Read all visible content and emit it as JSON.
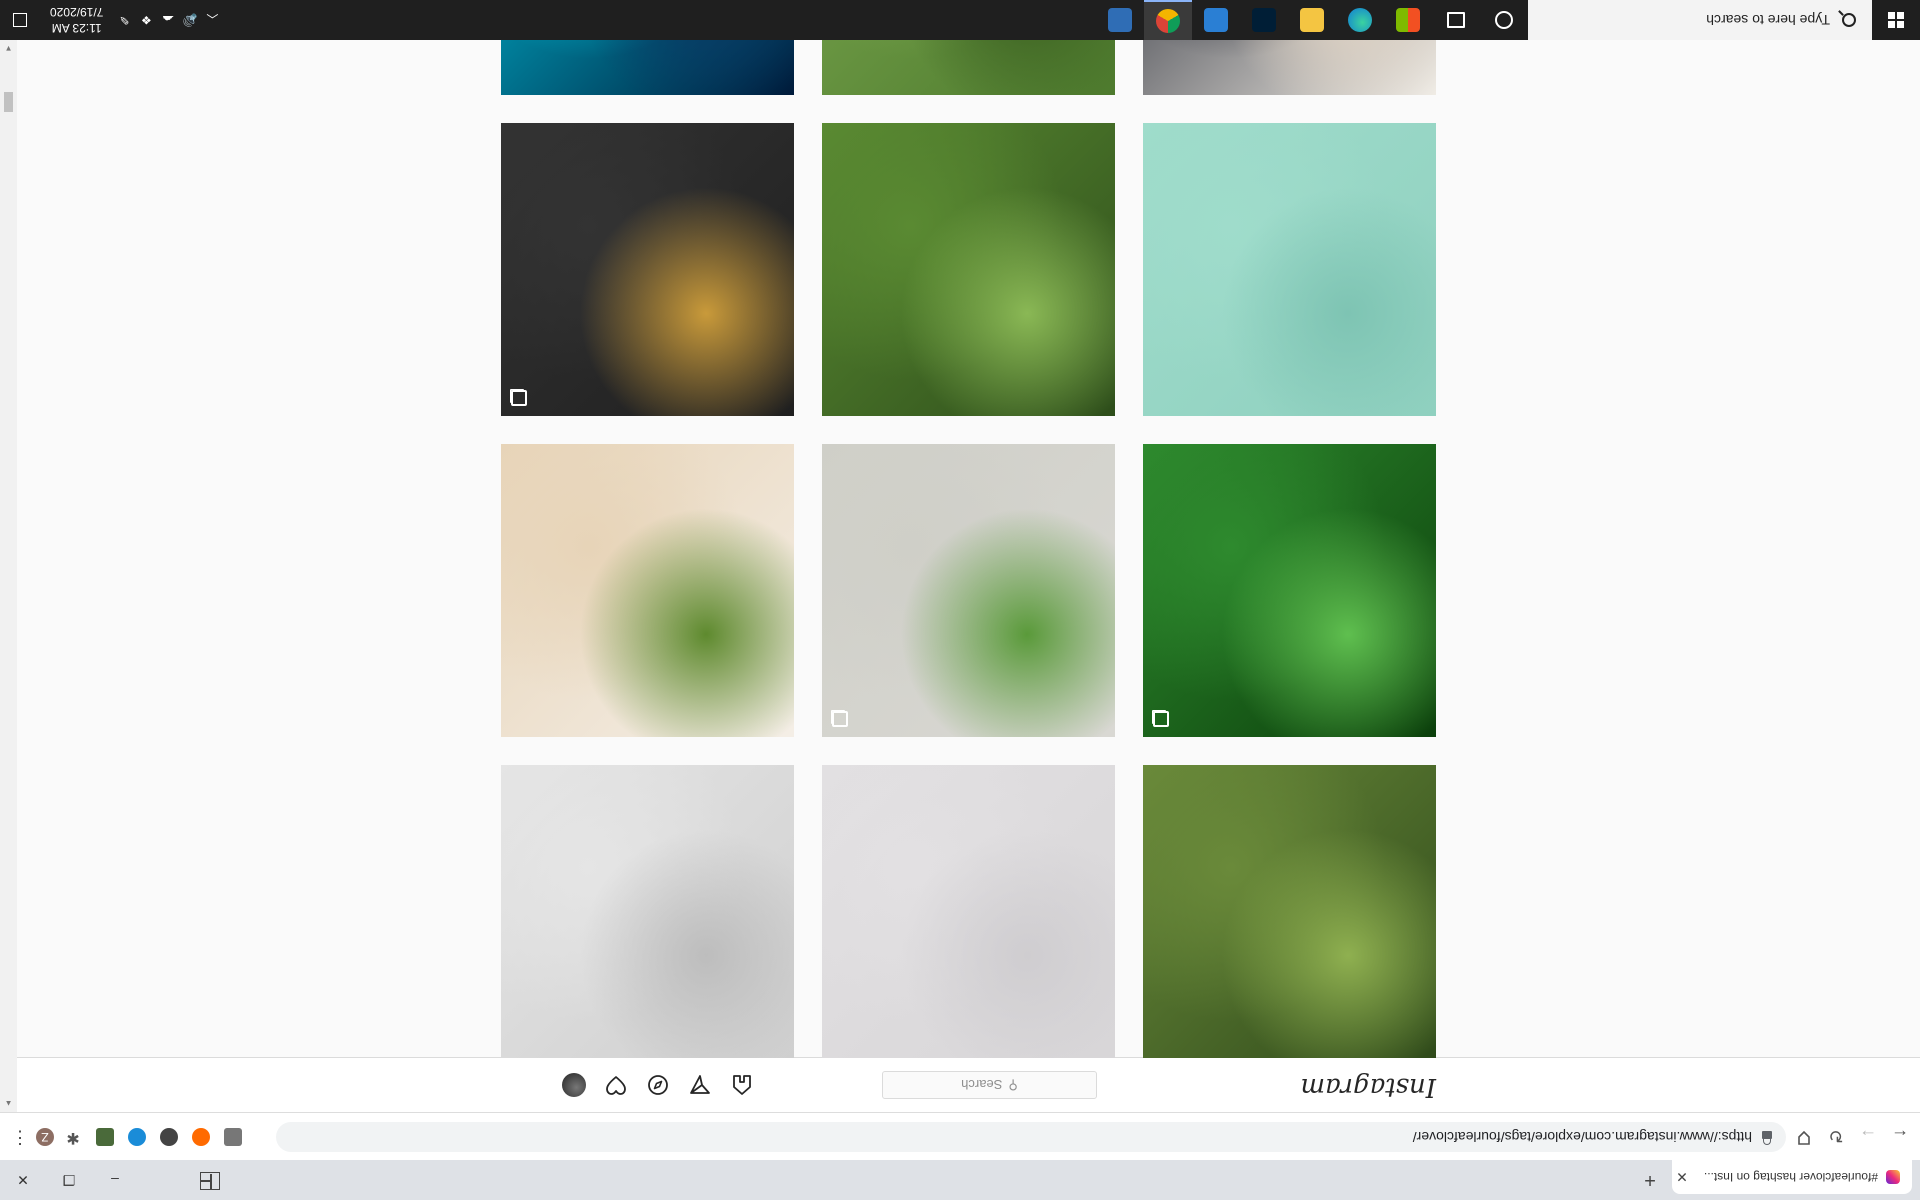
{
  "browser": {
    "tab_title": "#fourleafclover hashtag on Inst...",
    "tab_close": "✕",
    "new_tab": "+",
    "url": "https://www.instagram.com/explore/tags/fourleafclover/",
    "extension_avatar_letter": "Z",
    "window_controls": {
      "minimize": "–",
      "restore": "❐",
      "close": "✕"
    }
  },
  "instagram": {
    "logo": "Instagram",
    "search_placeholder": "Search",
    "nav_icons": [
      "home-icon",
      "direct-icon",
      "explore-icon",
      "activity-icon",
      "profile-avatar"
    ]
  },
  "grid": {
    "tiles": [
      {
        "name": "dog-grass",
        "colors": [
          "#2f4a1a",
          "#6a8a3a",
          "#8fb050"
        ],
        "multi": false
      },
      {
        "name": "grey-top-left",
        "colors": [
          "#d8d6d8",
          "#e2e0e2",
          "#cfcdd0"
        ],
        "multi": false
      },
      {
        "name": "grey-top-right",
        "colors": [
          "#cfcfcf",
          "#e5e5e5",
          "#bdbdbd"
        ],
        "multi": false
      },
      {
        "name": "green-leaves-pattern",
        "colors": [
          "#0b3f0b",
          "#2e8a2e",
          "#5fbf4f"
        ],
        "multi": true
      },
      {
        "name": "crochet-clover-earrings",
        "colors": [
          "#d9d8d3",
          "#cfcfc8",
          "#5a9a3a"
        ],
        "multi": true
      },
      {
        "name": "owl-figurine-clover",
        "colors": [
          "#f4eee6",
          "#e7d4b8",
          "#5e8a2e"
        ],
        "multi": false
      },
      {
        "name": "follow-your-dreams",
        "colors": [
          "#8fd0bf",
          "#9fdccb",
          "#7ec4b3"
        ],
        "multi": false
      },
      {
        "name": "hand-picking-clover",
        "colors": [
          "#2d4d1a",
          "#5a8a32",
          "#8ab855"
        ],
        "multi": false
      },
      {
        "name": "embroidered-cards",
        "colors": [
          "#1f1f1f",
          "#333333",
          "#c99a3a"
        ],
        "multi": true
      },
      {
        "name": "black-dress",
        "colors": [
          "#f0ece5",
          "#1a1e2a",
          "#e7d9c8"
        ],
        "multi": false
      },
      {
        "name": "clover-patch",
        "colors": [
          "#4d7a2d",
          "#7ca850",
          "#3a5f20"
        ],
        "multi": false
      },
      {
        "name": "blue-abstract",
        "colors": [
          "#001a3a",
          "#00c8e0",
          "#0a3a66"
        ],
        "multi": false
      }
    ]
  },
  "taskbar": {
    "search_placeholder": "Type here to search",
    "time": "11:23 AM",
    "date": "7/19/2020",
    "apps": [
      {
        "name": "cortana-icon",
        "color": "#ffffff"
      },
      {
        "name": "task-view-icon",
        "color": "#ffffff"
      },
      {
        "name": "microsoft-store-icon",
        "color": "#f25022"
      },
      {
        "name": "edge-icon",
        "color": "#0f7bd6"
      },
      {
        "name": "file-explorer-icon",
        "color": "#f4c542"
      },
      {
        "name": "photoshop-icon",
        "color": "#001e36"
      },
      {
        "name": "photos-icon",
        "color": "#2a7fd4"
      },
      {
        "name": "chrome-icon",
        "color": "#db4437"
      },
      {
        "name": "settings-app-icon",
        "color": "#2f6db5"
      }
    ]
  }
}
